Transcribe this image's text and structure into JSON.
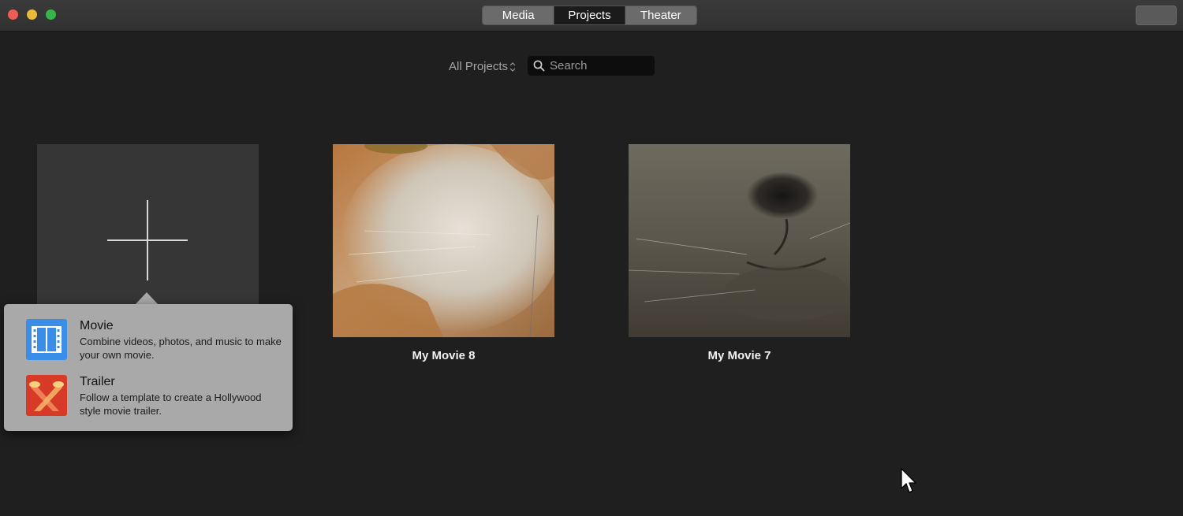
{
  "window": {
    "tabs": [
      {
        "label": "Media",
        "active": false
      },
      {
        "label": "Projects",
        "active": true
      },
      {
        "label": "Theater",
        "active": false
      }
    ]
  },
  "toolbar": {
    "filter_label": "All Projects",
    "search_placeholder": "Search",
    "search_value": ""
  },
  "projects": [
    {
      "title": "My Movie 8",
      "thumbnail": "orange-white-cat-closeup"
    },
    {
      "title": "My Movie 7",
      "thumbnail": "gray-cat-nose-closeup"
    }
  ],
  "new_project_popover": {
    "options": [
      {
        "title": "Movie",
        "description": "Combine videos, photos, and music to make your own movie.",
        "icon": "film-strip-icon",
        "icon_color": "#3a8ee8"
      },
      {
        "title": "Trailer",
        "description": "Follow a template to create a Hollywood style movie trailer.",
        "icon": "spotlights-icon",
        "icon_color": "#d83a28"
      }
    ]
  },
  "colors": {
    "background": "#1f1f1f",
    "popover": "#a9a9a9",
    "active_tab": "#1b1b1b",
    "inactive_tab": "#6b6b6b"
  }
}
